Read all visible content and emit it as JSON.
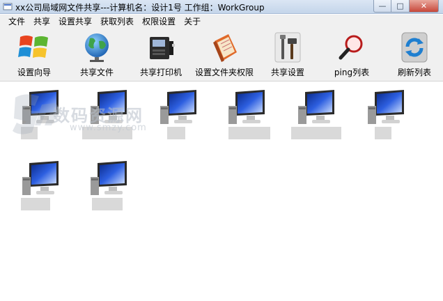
{
  "window": {
    "title": "xx公司局域网文件共享---计算机名：设计1号 工作组：WorkGroup",
    "minimize_glyph": "—",
    "maximize_glyph": "□",
    "close_glyph": "✕"
  },
  "menu": [
    "文件",
    "共享",
    "设置共享",
    "获取列表",
    "权限设置",
    "关于"
  ],
  "toolbar": [
    {
      "label": "设置向导",
      "icon": "windows-logo-icon"
    },
    {
      "label": "共享文件",
      "icon": "globe-icon"
    },
    {
      "label": "共享打印机",
      "icon": "printer-icon"
    },
    {
      "label": "设置文件夹权限",
      "icon": "notebook-icon"
    },
    {
      "label": "共享设置",
      "icon": "tools-icon"
    },
    {
      "label": "ping列表",
      "icon": "magnifier-icon"
    },
    {
      "label": "刷新列表",
      "icon": "refresh-icon"
    }
  ],
  "computers": [
    {
      "icon": "computer-icon",
      "name": ""
    },
    {
      "icon": "computer-icon",
      "name": ""
    },
    {
      "icon": "computer-icon",
      "name": ""
    },
    {
      "icon": "computer-icon",
      "name": ""
    },
    {
      "icon": "computer-icon",
      "name": ""
    },
    {
      "icon": "computer-icon",
      "name": ""
    },
    {
      "icon": "computer-icon",
      "name": ""
    },
    {
      "icon": "computer-icon",
      "name": ""
    }
  ],
  "watermark": {
    "cn": "数码资源网",
    "en": "www.smzy.com"
  },
  "colors": {
    "titlebar": "#c4d5ea",
    "toolbar": "#f0f0f0",
    "screen_blue": "#1a3fb8",
    "close_red": "#c7473a"
  }
}
